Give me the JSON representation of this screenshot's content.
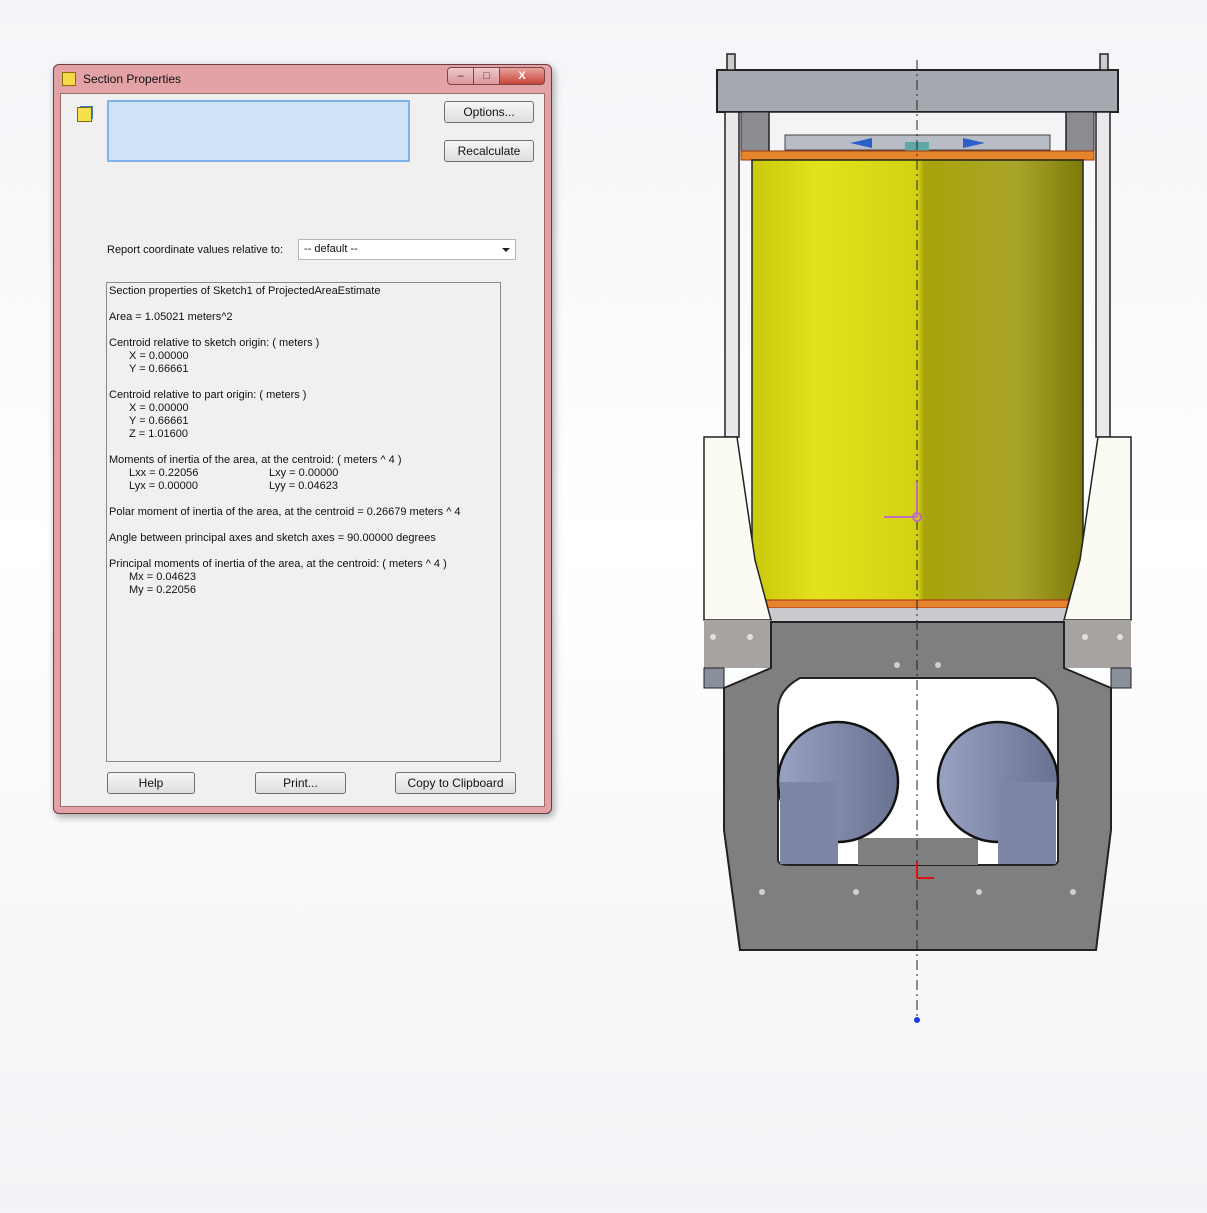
{
  "dialog": {
    "title": "Section Properties",
    "caption_buttons": {
      "minimize": "–",
      "maximize": "□",
      "close": "X"
    },
    "options_label": "Options...",
    "recalculate_label": "Recalculate",
    "report_relative_label": "Report coordinate values relative to:",
    "coordinate_select": "-- default --",
    "help_label": "Help",
    "print_label": "Print...",
    "clipboard_label": "Copy to Clipboard"
  },
  "report": {
    "heading": "Section properties of Sketch1 of ProjectedAreaEstimate",
    "area": "Area = 1.05021 meters^2",
    "centroid_sketch_label": "Centroid relative to sketch origin: ( meters )",
    "centroid_sketch_x": "X = 0.00000",
    "centroid_sketch_y": "Y = 0.66661",
    "centroid_part_label": "Centroid relative to part origin: ( meters )",
    "centroid_part_x": "X = 0.00000",
    "centroid_part_y": "Y = 0.66661",
    "centroid_part_z": "Z = 1.01600",
    "moments_label": "Moments of inertia of the area, at the centroid: ( meters ^ 4 )",
    "lxx": "Lxx = 0.22056",
    "lxy": "Lxy = 0.00000",
    "lyx": "Lyx = 0.00000",
    "lyy": "Lyy = 0.04623",
    "polar": "Polar moment of inertia of the area, at the centroid = 0.26679 meters ^ 4",
    "angle": "Angle between principal axes and sketch axes = 90.00000 degrees",
    "principal_label": "Principal moments of inertia of the area, at the centroid: ( meters ^ 4 )",
    "mx": "Mx = 0.04623",
    "my": "My = 0.22056"
  },
  "colors": {
    "window_frame": "#e3a2a6",
    "yellow_cylinder": "#d8d81a",
    "gray_plate": "#7d7d7d",
    "selection_box": "#cfe3f6"
  }
}
